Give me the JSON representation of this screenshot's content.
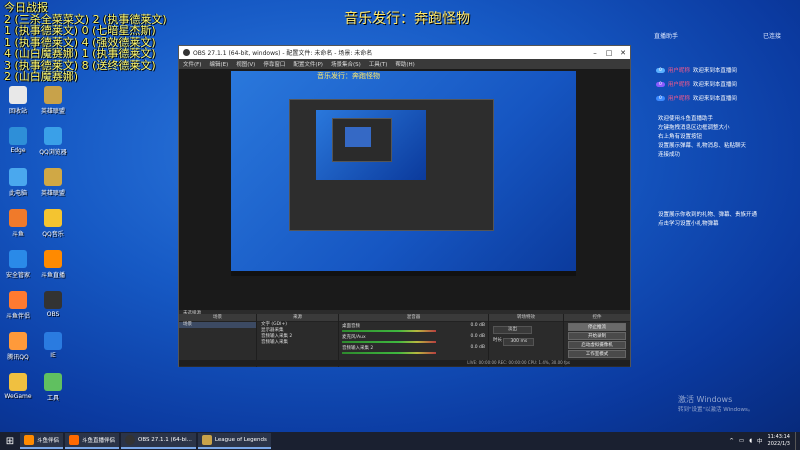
{
  "overlay": {
    "lines": [
      "今日战报",
      "2 (三杀全菜菜文) 2 (执事德莱文)",
      "1 (执事德莱文) 0 (七暗星杰斯)",
      "1 (执事德莱文) 4 (强效德莱文)",
      "4 (山白魔赛娜) 1 (执事德莱文)",
      "3 (执事德莱文) 8 (送终德莱文)",
      "2 (山白魔赛娜)"
    ],
    "marquee": "音乐发行：奔跑怪物"
  },
  "desktop_icons": [
    {
      "label": "回收站",
      "color": "#e8e8e8"
    },
    {
      "label": "英雄联盟",
      "color": "#c8a24a"
    },
    {
      "label": "Edge",
      "color": "#2e8fd8"
    },
    {
      "label": "QQ浏览器",
      "color": "#3aa0e8"
    },
    {
      "label": "此电脑",
      "color": "#4aa8ee"
    },
    {
      "label": "英雄联盟",
      "color": "#d0a845"
    },
    {
      "label": "斗鱼",
      "color": "#f07a2a"
    },
    {
      "label": "QQ音乐",
      "color": "#f4c430"
    },
    {
      "label": "安全管家",
      "color": "#2a8ae8"
    },
    {
      "label": "斗鱼直播",
      "color": "#ff8a00"
    },
    {
      "label": "斗鱼伴侣",
      "color": "#ff7a30"
    },
    {
      "label": "OBS",
      "color": "#333333"
    },
    {
      "label": "腾讯QQ",
      "color": "#ff9a3a"
    },
    {
      "label": "IE",
      "color": "#2a7be0"
    },
    {
      "label": "WeGame",
      "color": "#f0c040"
    },
    {
      "label": "工具",
      "color": "#60c060"
    }
  ],
  "obs": {
    "title": "OBS 27.1.1 (64-bit, windows) - 配置文件: 未命名 - 场景: 未命名",
    "menu": [
      "文件(F)",
      "编辑(E)",
      "视图(V)",
      "停靠窗口",
      "配置文件(P)",
      "场景集合(S)",
      "工具(T)",
      "帮助(H)"
    ],
    "preview_title": "音乐发行：奔跑怪物",
    "scene_label": "未选择源",
    "panels": {
      "scenes": "场景",
      "sources": "来源",
      "mixer": "混音器",
      "transitions": "转场特效",
      "controls": "控件"
    },
    "scene_item": "场景",
    "sources": [
      "文字 (GDI+)",
      "显示器采集",
      "音频输入采集 2",
      "音频输入采集"
    ],
    "mixer_rows": [
      {
        "name": "桌面音频",
        "db": "0.0 dB"
      },
      {
        "name": "麦克风/Aux",
        "db": "0.0 dB"
      },
      {
        "name": "音频输入采集 2",
        "db": "0.0 dB"
      }
    ],
    "transition": "淡出",
    "duration_label": "时长",
    "duration_value": "300 ms",
    "controls": [
      "停止推流",
      "开始录制",
      "启动虚拟摄像机",
      "工作室模式",
      "设置",
      "退出"
    ],
    "status": "LIVE: 00:00:00   REC: 00:00:00   CPU: 1.4%, 30.00 fps"
  },
  "chat": {
    "header_left": "直播助手",
    "header_right": "已连接",
    "messages": [
      {
        "badge": "0",
        "user": "用户昵称",
        "text": "欢迎来到本直播间"
      },
      {
        "badge": "0",
        "user": "用户昵称",
        "text": "欢迎来到本直播间"
      },
      {
        "badge": "0",
        "user": "用户昵称",
        "text": "欢迎来到本直播间"
      }
    ],
    "notice": [
      "欢迎使用斗鱼直播助手",
      "左键拖拽消息区边框调整大小",
      "右上角有设置按钮",
      "设置展示弹幕、礼物消息、粘贴聊天",
      "连接成功"
    ],
    "notice2": [
      "设置展示你收到的礼物、弹幕、贵族开通",
      "点击学习设置小礼物弹幕"
    ]
  },
  "watermark": {
    "line1": "激活 Windows",
    "line2": "转到\"设置\"以激活 Windows。"
  },
  "taskbar": {
    "apps": [
      {
        "label": "斗鱼伴侣",
        "color": "#ff8a00"
      },
      {
        "label": "斗鱼直播伴侣",
        "color": "#ff6a00"
      },
      {
        "label": "OBS 27.1.1 (64-bi...",
        "color": "#333333"
      },
      {
        "label": "League of Legends",
        "color": "#c8a24a"
      }
    ],
    "time": "11:43:14",
    "date": "2022/1/3"
  }
}
